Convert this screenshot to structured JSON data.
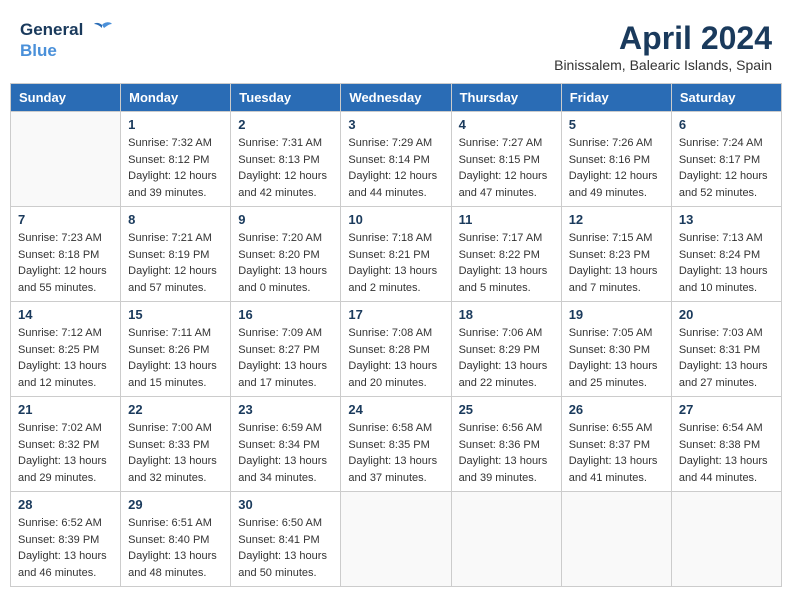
{
  "header": {
    "logo_line1": "General",
    "logo_line2": "Blue",
    "month_title": "April 2024",
    "location": "Binissalem, Balearic Islands, Spain"
  },
  "days_of_week": [
    "Sunday",
    "Monday",
    "Tuesday",
    "Wednesday",
    "Thursday",
    "Friday",
    "Saturday"
  ],
  "weeks": [
    [
      {
        "day": "",
        "sunrise": "",
        "sunset": "",
        "daylight": ""
      },
      {
        "day": "1",
        "sunrise": "Sunrise: 7:32 AM",
        "sunset": "Sunset: 8:12 PM",
        "daylight": "Daylight: 12 hours and 39 minutes."
      },
      {
        "day": "2",
        "sunrise": "Sunrise: 7:31 AM",
        "sunset": "Sunset: 8:13 PM",
        "daylight": "Daylight: 12 hours and 42 minutes."
      },
      {
        "day": "3",
        "sunrise": "Sunrise: 7:29 AM",
        "sunset": "Sunset: 8:14 PM",
        "daylight": "Daylight: 12 hours and 44 minutes."
      },
      {
        "day": "4",
        "sunrise": "Sunrise: 7:27 AM",
        "sunset": "Sunset: 8:15 PM",
        "daylight": "Daylight: 12 hours and 47 minutes."
      },
      {
        "day": "5",
        "sunrise": "Sunrise: 7:26 AM",
        "sunset": "Sunset: 8:16 PM",
        "daylight": "Daylight: 12 hours and 49 minutes."
      },
      {
        "day": "6",
        "sunrise": "Sunrise: 7:24 AM",
        "sunset": "Sunset: 8:17 PM",
        "daylight": "Daylight: 12 hours and 52 minutes."
      }
    ],
    [
      {
        "day": "7",
        "sunrise": "Sunrise: 7:23 AM",
        "sunset": "Sunset: 8:18 PM",
        "daylight": "Daylight: 12 hours and 55 minutes."
      },
      {
        "day": "8",
        "sunrise": "Sunrise: 7:21 AM",
        "sunset": "Sunset: 8:19 PM",
        "daylight": "Daylight: 12 hours and 57 minutes."
      },
      {
        "day": "9",
        "sunrise": "Sunrise: 7:20 AM",
        "sunset": "Sunset: 8:20 PM",
        "daylight": "Daylight: 13 hours and 0 minutes."
      },
      {
        "day": "10",
        "sunrise": "Sunrise: 7:18 AM",
        "sunset": "Sunset: 8:21 PM",
        "daylight": "Daylight: 13 hours and 2 minutes."
      },
      {
        "day": "11",
        "sunrise": "Sunrise: 7:17 AM",
        "sunset": "Sunset: 8:22 PM",
        "daylight": "Daylight: 13 hours and 5 minutes."
      },
      {
        "day": "12",
        "sunrise": "Sunrise: 7:15 AM",
        "sunset": "Sunset: 8:23 PM",
        "daylight": "Daylight: 13 hours and 7 minutes."
      },
      {
        "day": "13",
        "sunrise": "Sunrise: 7:13 AM",
        "sunset": "Sunset: 8:24 PM",
        "daylight": "Daylight: 13 hours and 10 minutes."
      }
    ],
    [
      {
        "day": "14",
        "sunrise": "Sunrise: 7:12 AM",
        "sunset": "Sunset: 8:25 PM",
        "daylight": "Daylight: 13 hours and 12 minutes."
      },
      {
        "day": "15",
        "sunrise": "Sunrise: 7:11 AM",
        "sunset": "Sunset: 8:26 PM",
        "daylight": "Daylight: 13 hours and 15 minutes."
      },
      {
        "day": "16",
        "sunrise": "Sunrise: 7:09 AM",
        "sunset": "Sunset: 8:27 PM",
        "daylight": "Daylight: 13 hours and 17 minutes."
      },
      {
        "day": "17",
        "sunrise": "Sunrise: 7:08 AM",
        "sunset": "Sunset: 8:28 PM",
        "daylight": "Daylight: 13 hours and 20 minutes."
      },
      {
        "day": "18",
        "sunrise": "Sunrise: 7:06 AM",
        "sunset": "Sunset: 8:29 PM",
        "daylight": "Daylight: 13 hours and 22 minutes."
      },
      {
        "day": "19",
        "sunrise": "Sunrise: 7:05 AM",
        "sunset": "Sunset: 8:30 PM",
        "daylight": "Daylight: 13 hours and 25 minutes."
      },
      {
        "day": "20",
        "sunrise": "Sunrise: 7:03 AM",
        "sunset": "Sunset: 8:31 PM",
        "daylight": "Daylight: 13 hours and 27 minutes."
      }
    ],
    [
      {
        "day": "21",
        "sunrise": "Sunrise: 7:02 AM",
        "sunset": "Sunset: 8:32 PM",
        "daylight": "Daylight: 13 hours and 29 minutes."
      },
      {
        "day": "22",
        "sunrise": "Sunrise: 7:00 AM",
        "sunset": "Sunset: 8:33 PM",
        "daylight": "Daylight: 13 hours and 32 minutes."
      },
      {
        "day": "23",
        "sunrise": "Sunrise: 6:59 AM",
        "sunset": "Sunset: 8:34 PM",
        "daylight": "Daylight: 13 hours and 34 minutes."
      },
      {
        "day": "24",
        "sunrise": "Sunrise: 6:58 AM",
        "sunset": "Sunset: 8:35 PM",
        "daylight": "Daylight: 13 hours and 37 minutes."
      },
      {
        "day": "25",
        "sunrise": "Sunrise: 6:56 AM",
        "sunset": "Sunset: 8:36 PM",
        "daylight": "Daylight: 13 hours and 39 minutes."
      },
      {
        "day": "26",
        "sunrise": "Sunrise: 6:55 AM",
        "sunset": "Sunset: 8:37 PM",
        "daylight": "Daylight: 13 hours and 41 minutes."
      },
      {
        "day": "27",
        "sunrise": "Sunrise: 6:54 AM",
        "sunset": "Sunset: 8:38 PM",
        "daylight": "Daylight: 13 hours and 44 minutes."
      }
    ],
    [
      {
        "day": "28",
        "sunrise": "Sunrise: 6:52 AM",
        "sunset": "Sunset: 8:39 PM",
        "daylight": "Daylight: 13 hours and 46 minutes."
      },
      {
        "day": "29",
        "sunrise": "Sunrise: 6:51 AM",
        "sunset": "Sunset: 8:40 PM",
        "daylight": "Daylight: 13 hours and 48 minutes."
      },
      {
        "day": "30",
        "sunrise": "Sunrise: 6:50 AM",
        "sunset": "Sunset: 8:41 PM",
        "daylight": "Daylight: 13 hours and 50 minutes."
      },
      {
        "day": "",
        "sunrise": "",
        "sunset": "",
        "daylight": ""
      },
      {
        "day": "",
        "sunrise": "",
        "sunset": "",
        "daylight": ""
      },
      {
        "day": "",
        "sunrise": "",
        "sunset": "",
        "daylight": ""
      },
      {
        "day": "",
        "sunrise": "",
        "sunset": "",
        "daylight": ""
      }
    ]
  ]
}
